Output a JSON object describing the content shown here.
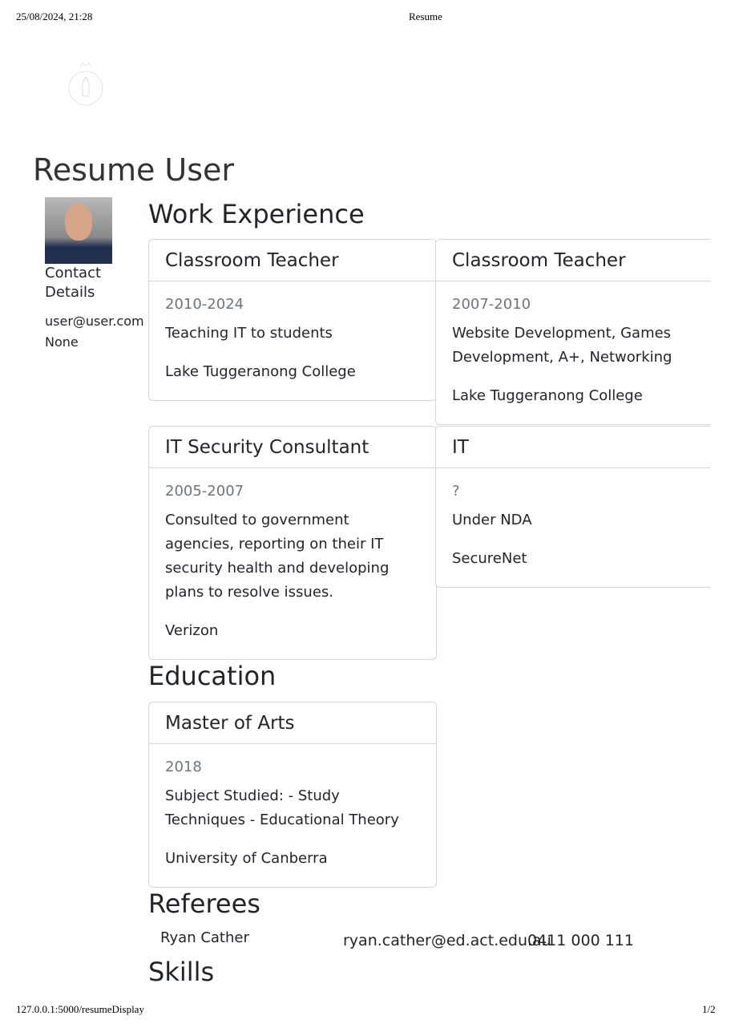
{
  "print_header": {
    "datetime": "25/08/2024, 21:28",
    "title": "Resume"
  },
  "print_footer": {
    "url": "127.0.0.1:5000/resumeDisplay",
    "page": "1/2"
  },
  "name": "Resume User",
  "contact": {
    "heading": "Contact Details",
    "email": "user@user.com",
    "phone": "None"
  },
  "sections": {
    "work": "Work Experience",
    "education": "Education",
    "referees": "Referees",
    "skills": "Skills"
  },
  "work": [
    {
      "title": "Classroom Teacher",
      "years": "2010-2024",
      "description": "Teaching IT to students",
      "company": "Lake Tuggeranong College"
    },
    {
      "title": "Classroom Teacher",
      "years": "2007-2010",
      "description": "Website Development, Games Development, A+, Networking",
      "company": "Lake Tuggeranong College"
    },
    {
      "title": "IT Security Consultant",
      "years": "2005-2007",
      "description": "Consulted to government agencies, reporting on their IT security health and developing plans to resolve issues.",
      "company": "Verizon"
    },
    {
      "title": "IT",
      "years": "?",
      "description": "Under NDA",
      "company": "SecureNet"
    }
  ],
  "education": [
    {
      "degree": "Master of Arts",
      "year": "2018",
      "subject": "Subject Studied: - Study Techniques - Educational Theory",
      "institution": "University of Canberra"
    }
  ],
  "referees": [
    {
      "name": "Ryan Cather",
      "email": "ryan.cather@ed.act.edu.au",
      "phone": "0411 000 111"
    }
  ]
}
